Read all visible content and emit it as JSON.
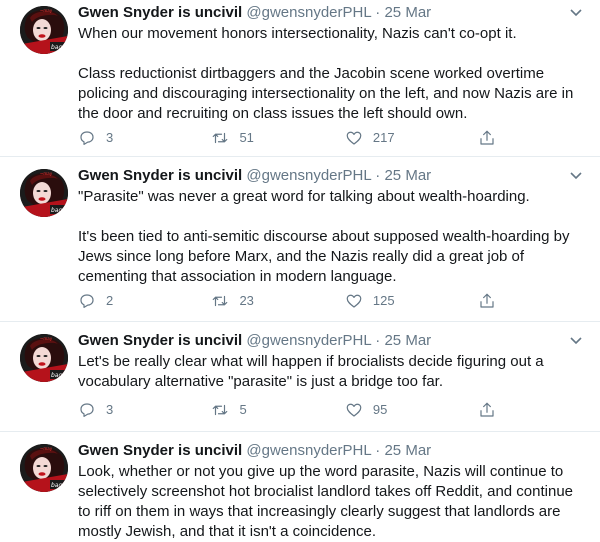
{
  "tweets": [
    {
      "name": "Gwen Snyder is uncivil",
      "handle": "@gwensnyderPHL",
      "separator": "·",
      "date": "25 Mar",
      "paragraphs": [
        "When our movement honors intersectionality, Nazis can't co-opt it.",
        "Class reductionist dirtbaggers and the Jacobin scene worked overtime policing and discouraging intersectionality on the left, and now Nazis are in the door and recruiting on class issues the left should own."
      ],
      "replies": "3",
      "retweets": "51",
      "likes": "217"
    },
    {
      "name": "Gwen Snyder is uncivil",
      "handle": "@gwensnyderPHL",
      "separator": "·",
      "date": "25 Mar",
      "paragraphs": [
        "\"Parasite\" was never a great word for talking about wealth-hoarding.",
        "It's been tied to anti-semitic discourse about supposed wealth-hoarding by Jews since long before Marx, and the Nazis really did a great job of cementing that association in modern language."
      ],
      "replies": "2",
      "retweets": "23",
      "likes": "125"
    },
    {
      "name": "Gwen Snyder is uncivil",
      "handle": "@gwensnyderPHL",
      "separator": "·",
      "date": "25 Mar",
      "paragraphs": [
        "Let's be really clear what will happen if brocialists decide figuring out a vocabulary alternative \"parasite\" is just a bridge too far."
      ],
      "replies": "3",
      "retweets": "5",
      "likes": "95"
    },
    {
      "name": "Gwen Snyder is uncivil",
      "handle": "@gwensnyderPHL",
      "separator": "·",
      "date": "25 Mar",
      "paragraphs": [
        "Look, whether or not you give up the word parasite, Nazis will continue to selectively screenshot hot brocialist landlord takes off Reddit, and continue to riff on them in ways that increasingly clearly suggest that landlords are mostly Jewish, and that it isn't a coincidence."
      ]
    }
  ],
  "icons": {
    "reply": "reply-icon",
    "retweet": "retweet-icon",
    "like": "like-icon",
    "share": "share-icon",
    "caret": "chevron-down-icon"
  },
  "colors": {
    "text": "#14171a",
    "secondary": "#657786",
    "divider": "#e6ecf0"
  }
}
